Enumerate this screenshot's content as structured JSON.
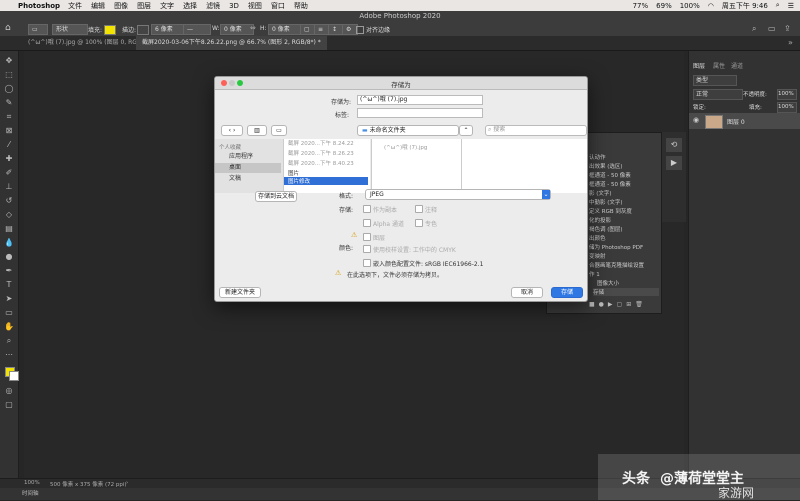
{
  "menubar": {
    "app_name": "Photoshop",
    "items": [
      "文件",
      "编辑",
      "图像",
      "图层",
      "文字",
      "选择",
      "滤镜",
      "3D",
      "视图",
      "窗口",
      "帮助"
    ],
    "status_right": [
      "77%",
      "69%",
      "100%"
    ],
    "datetime": "周五下午 9:46"
  },
  "options_bar": {
    "window_title": "Adobe Photoshop 2020",
    "shape_mode": "形状",
    "fill_label": "填充:",
    "stroke_label": "描边:",
    "stroke_size": "6 像素",
    "w_label": "W:",
    "w_value": "0 像素",
    "h_label": "H:",
    "h_value": "0 像素",
    "align_edges": "对齐边缘"
  },
  "tabs": [
    {
      "label": "(^ω^)哦 (7).jpg @ 100% (图层 0, RGB/8#) *",
      "active": false
    },
    {
      "label": "截屏2020-03-06下午8.26.22.png @ 66.7% (图形 2, RGB/8*) *",
      "active": true
    }
  ],
  "dialog": {
    "title": "存储为",
    "save_as_label": "存储为:",
    "filename": "(^ω^)哦 (7).jpg",
    "tags_label": "标签:",
    "location": "未命名文件夹",
    "search_placeholder": "搜索",
    "favorites_label": "个人收藏",
    "sidebar": [
      "应用程序",
      "桌面",
      "文稿"
    ],
    "files_col1": [
      "截屏 2020...下午 8.24.22",
      "截屏 2020...下午 8.26.23",
      "截屏 2020...下午 8.40.23",
      "图片",
      "图片修改"
    ],
    "files_col2": [
      "(^ω^)哦 (7).jpg"
    ],
    "save_cloud_button": "存储到云文档",
    "format_label": "格式:",
    "format_value": "JPEG",
    "save_label": "存储:",
    "opt_as_copy": "作为副本",
    "opt_notes": "注释",
    "opt_alpha": "Alpha 通道",
    "opt_spot": "专色",
    "opt_layers": "图层",
    "color_label": "颜色:",
    "opt_proof": "使用校样设置: 工作中的 CMYK",
    "opt_embed": "嵌入颜色配置文件: sRGB IEC61966-2.1",
    "warning": "在此选项下，文件必须存储为拷贝。",
    "new_folder_button": "新建文件夹",
    "cancel_button": "取消",
    "save_button": "存储"
  },
  "actions_panel": {
    "items": [
      "认动作",
      "出效果 (选区)",
      "框通道 - 50 像素",
      "框通道 - 50 像素",
      "影 (文字)",
      "中勤影 (文字)",
      "定义 RGB 到灰度",
      "化的投影",
      "褐色调 (图层)",
      "出颜色",
      "储为 Photoshop PDF",
      "变映射",
      "合器画笔克隆描绘设置",
      "作 1",
      "图像大小",
      "存储"
    ]
  },
  "right_panel": {
    "tabs": [
      "图层",
      "属性",
      "通道"
    ],
    "kind_label": "类型",
    "blend_mode": "正常",
    "opacity_label": "不透明度:",
    "opacity_value": "100%",
    "lock_label": "锁定:",
    "fill_label": "填充:",
    "fill_value": "100%",
    "layer_name": "图层 0"
  },
  "status_bar": {
    "zoom": "100%",
    "doc_info": "500 像素 x 375 像素 (72 ppi)"
  },
  "timeline_label": "时间轴",
  "watermark": {
    "text1": "头条",
    "text2": "@薄荷堂堂主",
    "text3": "家游网"
  },
  "colors": {
    "accent": "#2f78e4",
    "fill_swatch": "#f2e400"
  }
}
